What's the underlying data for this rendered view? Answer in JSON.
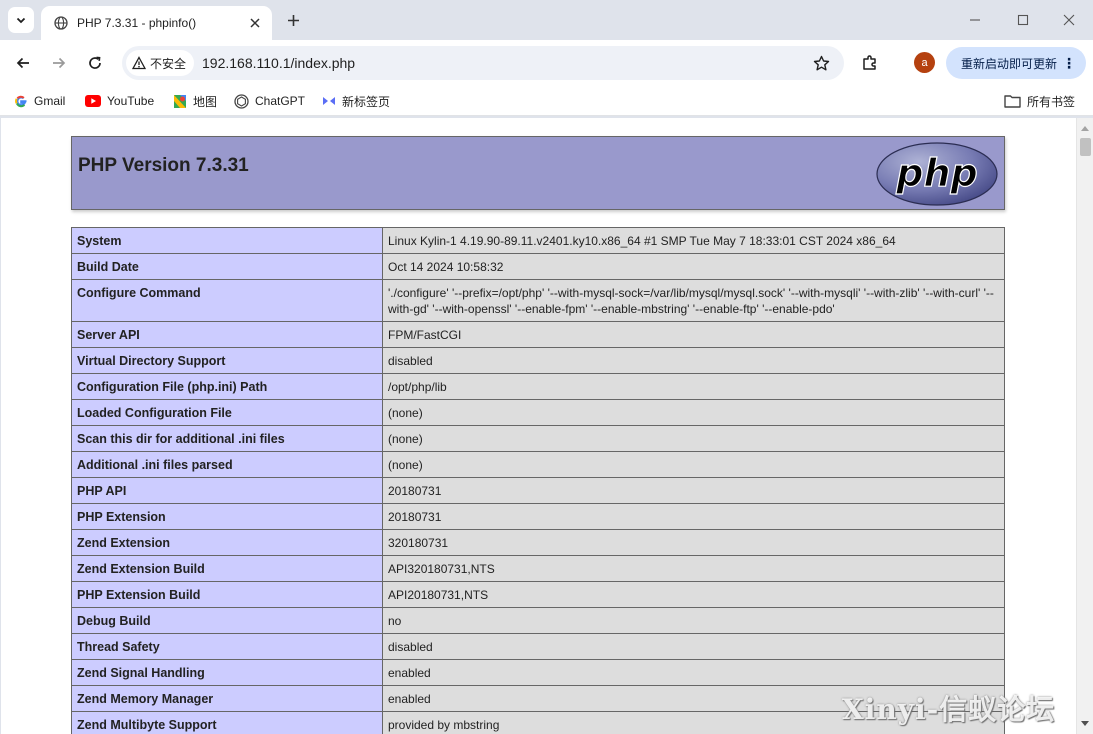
{
  "tab": {
    "title": "PHP 7.3.31 - phpinfo()"
  },
  "toolbar": {
    "security_label": "不安全",
    "url": "192.168.110.1/index.php",
    "avatar_letter": "a",
    "update_label": "重新启动即可更新"
  },
  "bookmarks": {
    "items": [
      {
        "label": "Gmail",
        "icon": "google-icon"
      },
      {
        "label": "YouTube",
        "icon": "youtube-icon"
      },
      {
        "label": "地图",
        "icon": "maps-icon"
      },
      {
        "label": "ChatGPT",
        "icon": "chatgpt-icon"
      },
      {
        "label": "新标签页",
        "icon": "new-tab-page-icon"
      }
    ],
    "all_bookmarks": "所有书签"
  },
  "page": {
    "heading": "PHP Version 7.3.31",
    "logo_text": "php",
    "rows": [
      {
        "name": "System",
        "value": "Linux Kylin-1 4.19.90-89.11.v2401.ky10.x86_64 #1 SMP Tue May 7 18:33:01 CST 2024 x86_64"
      },
      {
        "name": "Build Date",
        "value": "Oct 14 2024 10:58:32"
      },
      {
        "name": "Configure Command",
        "value": "'./configure' '--prefix=/opt/php' '--with-mysql-sock=/var/lib/mysql/mysql.sock' '--with-mysqli' '--with-zlib' '--with-curl' '--with-gd' '--with-openssl' '--enable-fpm' '--enable-mbstring' '--enable-ftp' '--enable-pdo'"
      },
      {
        "name": "Server API",
        "value": "FPM/FastCGI"
      },
      {
        "name": "Virtual Directory Support",
        "value": "disabled"
      },
      {
        "name": "Configuration File (php.ini) Path",
        "value": "/opt/php/lib"
      },
      {
        "name": "Loaded Configuration File",
        "value": "(none)"
      },
      {
        "name": "Scan this dir for additional .ini files",
        "value": "(none)"
      },
      {
        "name": "Additional .ini files parsed",
        "value": "(none)"
      },
      {
        "name": "PHP API",
        "value": "20180731"
      },
      {
        "name": "PHP Extension",
        "value": "20180731"
      },
      {
        "name": "Zend Extension",
        "value": "320180731"
      },
      {
        "name": "Zend Extension Build",
        "value": "API320180731,NTS"
      },
      {
        "name": "PHP Extension Build",
        "value": "API20180731,NTS"
      },
      {
        "name": "Debug Build",
        "value": "no"
      },
      {
        "name": "Thread Safety",
        "value": "disabled"
      },
      {
        "name": "Zend Signal Handling",
        "value": "enabled"
      },
      {
        "name": "Zend Memory Manager",
        "value": "enabled"
      },
      {
        "name": "Zend Multibyte Support",
        "value": "provided by mbstring"
      }
    ]
  },
  "watermark": "Xinyi-信蚁论坛"
}
